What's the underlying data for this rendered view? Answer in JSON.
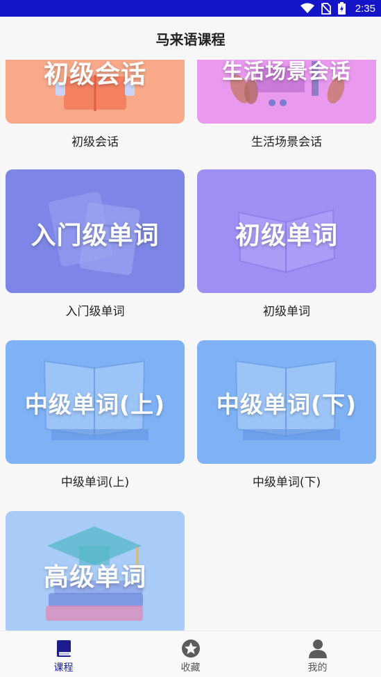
{
  "status_bar": {
    "time": "2:35"
  },
  "header": {
    "title": "马来语课程"
  },
  "courses": [
    {
      "label": "初级会话",
      "thumb_text": "初级会话",
      "color": "#f7a98a"
    },
    {
      "label": "生活场景会话",
      "thumb_text": "生活场景会话",
      "color": "#e999ee"
    },
    {
      "label": "入门级单词",
      "thumb_text": "入门级单词",
      "color": "#7d86e6"
    },
    {
      "label": "初级单词",
      "thumb_text": "初级单词",
      "color": "#9e8ff5"
    },
    {
      "label": "中级单词(上)",
      "thumb_text": "中级单词(上)",
      "color": "#7fb2f5"
    },
    {
      "label": "中级单词(下)",
      "thumb_text": "中级单词(下)",
      "color": "#7fb2f5"
    },
    {
      "label": "高级单词",
      "thumb_text": "高级单词",
      "color": "#a9cbf7"
    }
  ],
  "tabs": [
    {
      "label": "课程",
      "icon": "book-icon",
      "active": true
    },
    {
      "label": "收藏",
      "icon": "star-icon",
      "active": false
    },
    {
      "label": "我的",
      "icon": "person-icon",
      "active": false
    }
  ]
}
